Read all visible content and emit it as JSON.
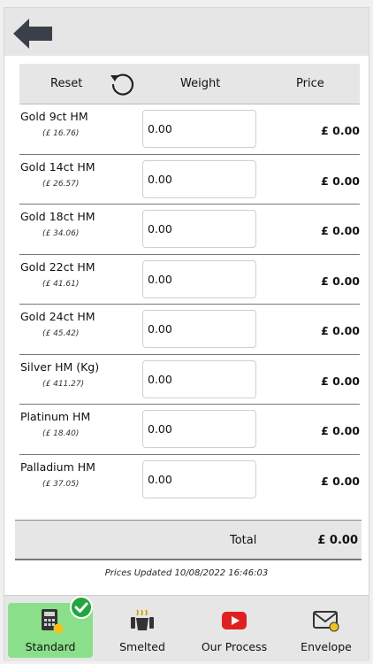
{
  "header": {
    "reset_label": "Reset",
    "weight_label": "Weight",
    "price_label": "Price"
  },
  "rows": [
    {
      "name": "Gold 9ct HM",
      "rate": "(£ 16.76)",
      "weight": "0.00",
      "price": "£ 0.00"
    },
    {
      "name": "Gold 14ct HM",
      "rate": "(£ 26.57)",
      "weight": "0.00",
      "price": "£ 0.00"
    },
    {
      "name": "Gold 18ct HM",
      "rate": "(£ 34.06)",
      "weight": "0.00",
      "price": "£ 0.00"
    },
    {
      "name": "Gold 22ct HM",
      "rate": "(£ 41.61)",
      "weight": "0.00",
      "price": "£ 0.00"
    },
    {
      "name": "Gold 24ct HM",
      "rate": "(£ 45.42)",
      "weight": "0.00",
      "price": "£ 0.00"
    },
    {
      "name": "Silver HM (Kg)",
      "rate": "(£ 411.27)",
      "weight": "0.00",
      "price": "£ 0.00"
    },
    {
      "name": "Platinum HM",
      "rate": "(£ 18.40)",
      "weight": "0.00",
      "price": "£ 0.00"
    },
    {
      "name": "Palladium HM",
      "rate": "(£ 37.05)",
      "weight": "0.00",
      "price": "£ 0.00"
    }
  ],
  "total": {
    "label": "Total",
    "value": "£ 0.00"
  },
  "updated_text": "Prices Updated 10/08/2022 16:46:03",
  "tabs": [
    {
      "label": "Standard",
      "icon": "calculator-icon",
      "active": true
    },
    {
      "label": "Smelted",
      "icon": "crucible-icon",
      "active": false
    },
    {
      "label": "Our Process",
      "icon": "youtube-icon",
      "active": false
    },
    {
      "label": "Envelope",
      "icon": "envelope-icon",
      "active": false
    }
  ],
  "colors": {
    "active_tab": "#8ae08a",
    "check_badge": "#22a53d",
    "youtube_red": "#e02020",
    "bar_gray": "#e6e6e6"
  }
}
